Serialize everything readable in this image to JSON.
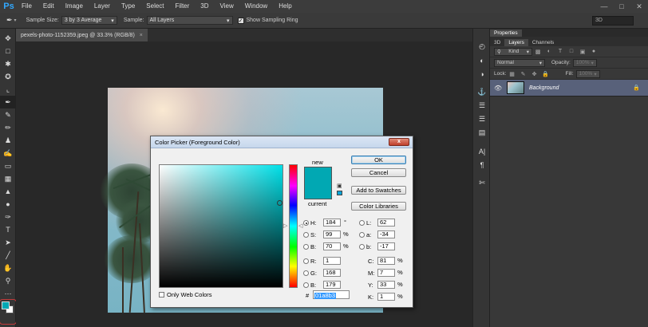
{
  "app": {
    "logo": "Ps"
  },
  "menu": [
    "File",
    "Edit",
    "Image",
    "Layer",
    "Type",
    "Select",
    "Filter",
    "3D",
    "View",
    "Window",
    "Help"
  ],
  "options": {
    "sample_size_label": "Sample Size:",
    "sample_size_value": "3 by 3 Average",
    "sample_label": "Sample:",
    "sample_value": "All Layers",
    "ring_label": "Show Sampling Ring",
    "workspace": "3D"
  },
  "document": {
    "tab_title": "pexels-photo-1152359.jpeg @ 33.3% (RGB/8)",
    "close": "×"
  },
  "panels": {
    "properties_tab": "Properties",
    "tabs": [
      "3D",
      "Layers",
      "Channels"
    ],
    "kind_label": "Kind",
    "blend_mode": "Normal",
    "opacity_label": "Opacity:",
    "opacity_value": "100%",
    "lock_label": "Lock:",
    "fill_label": "Fill:",
    "fill_value": "100%",
    "layer_name": "Background"
  },
  "dialog": {
    "title": "Color Picker (Foreground Color)",
    "close": "x",
    "new_label": "new",
    "current_label": "current",
    "buttons": {
      "ok": "OK",
      "cancel": "Cancel",
      "add_swatches": "Add to Swatches",
      "libraries": "Color Libraries"
    },
    "hsb": {
      "h_label": "H:",
      "h": "184",
      "h_unit": "°",
      "s_label": "S:",
      "s": "99",
      "s_unit": "%",
      "b_label": "B:",
      "b": "70",
      "b_unit": "%"
    },
    "rgb": {
      "r_label": "R:",
      "r": "1",
      "g_label": "G:",
      "g": "168",
      "b_label": "B:",
      "b": "179"
    },
    "lab": {
      "l_label": "L:",
      "l": "62",
      "a_label": "a:",
      "a": "-34",
      "b_label": "b:",
      "b": "-17"
    },
    "cmyk": {
      "c_label": "C:",
      "c": "81",
      "m_label": "M:",
      "m": "7",
      "y_label": "Y:",
      "y": "33",
      "k_label": "K:",
      "k": "1",
      "unit": "%"
    },
    "hex_label": "#",
    "hex": "01a8b3",
    "web_colors_label": "Only Web Colors",
    "color": "#01a8b3"
  }
}
